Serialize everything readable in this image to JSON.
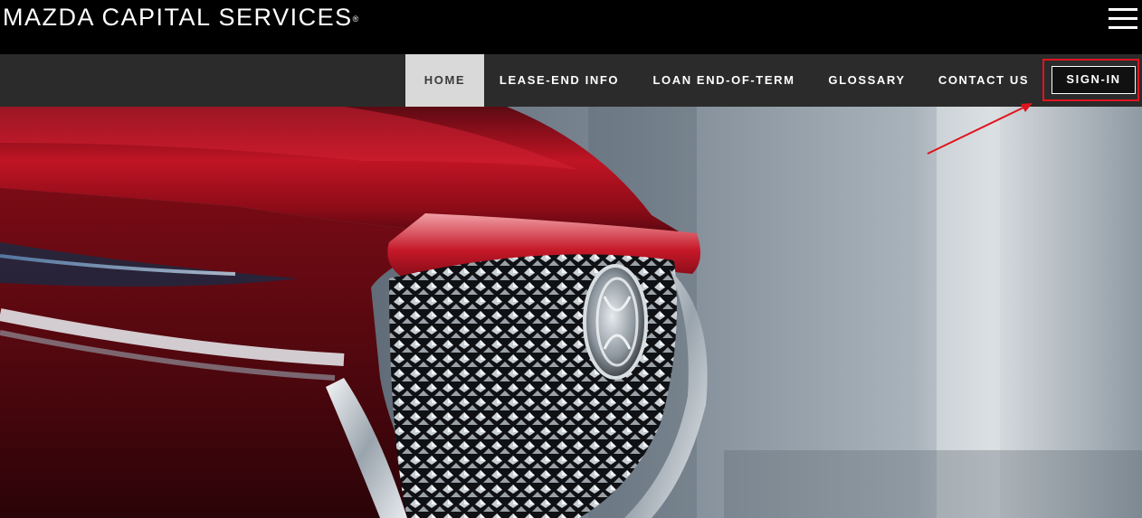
{
  "brand": {
    "name": "MAZDA CAPITAL SERVICES",
    "trademark": "®"
  },
  "header": {
    "menu_icon": "hamburger-menu-icon"
  },
  "nav": {
    "items": [
      {
        "label": "HOME",
        "active": true
      },
      {
        "label": "LEASE-END INFO",
        "active": false
      },
      {
        "label": "LOAN END-OF-TERM",
        "active": false
      },
      {
        "label": "GLOSSARY",
        "active": false
      },
      {
        "label": "CONTACT US",
        "active": false
      }
    ],
    "signin_label": "SIGN-IN"
  },
  "hero": {
    "image": "red-mazda-front-grille-closeup"
  },
  "annotation": {
    "highlight_color": "#e0141e",
    "target": "sign-in-button"
  },
  "colors": {
    "brand_bar": "#000000",
    "nav_bar": "#2b2b2b",
    "active_tab": "#d9d9d9",
    "car_red": "#9e0d1a"
  }
}
